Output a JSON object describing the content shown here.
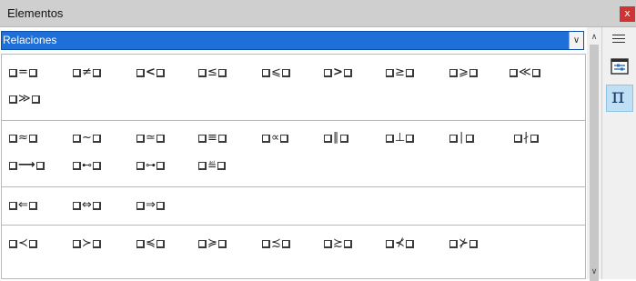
{
  "window": {
    "title": "Elementos",
    "close_label": "x"
  },
  "category_select": {
    "value": "Relaciones",
    "arrow": "chevron-down-icon"
  },
  "sidebar": {
    "menu_icon": "hamburger-menu-icon",
    "properties_icon": "properties-icon",
    "elements_icon": "pi-icon",
    "elements_label": "π"
  },
  "symbols": [
    [
      [
        "=",
        "≠",
        "<",
        "≤",
        "⩽",
        ">",
        "≥",
        "⩾",
        "≪",
        "≫"
      ]
    ],
    [
      [
        "≈",
        "~",
        "≃",
        "≡",
        "∝",
        "∥",
        "⊥",
        "∣",
        "∤",
        "⟶",
        "⊷",
        "⊶",
        "≝"
      ]
    ],
    [
      [
        "⇐",
        "⇔",
        "⇒"
      ]
    ],
    [
      [
        "≺",
        "≻",
        "≼",
        "≽",
        "≾",
        "≿",
        "⊀",
        "⊁"
      ]
    ]
  ]
}
